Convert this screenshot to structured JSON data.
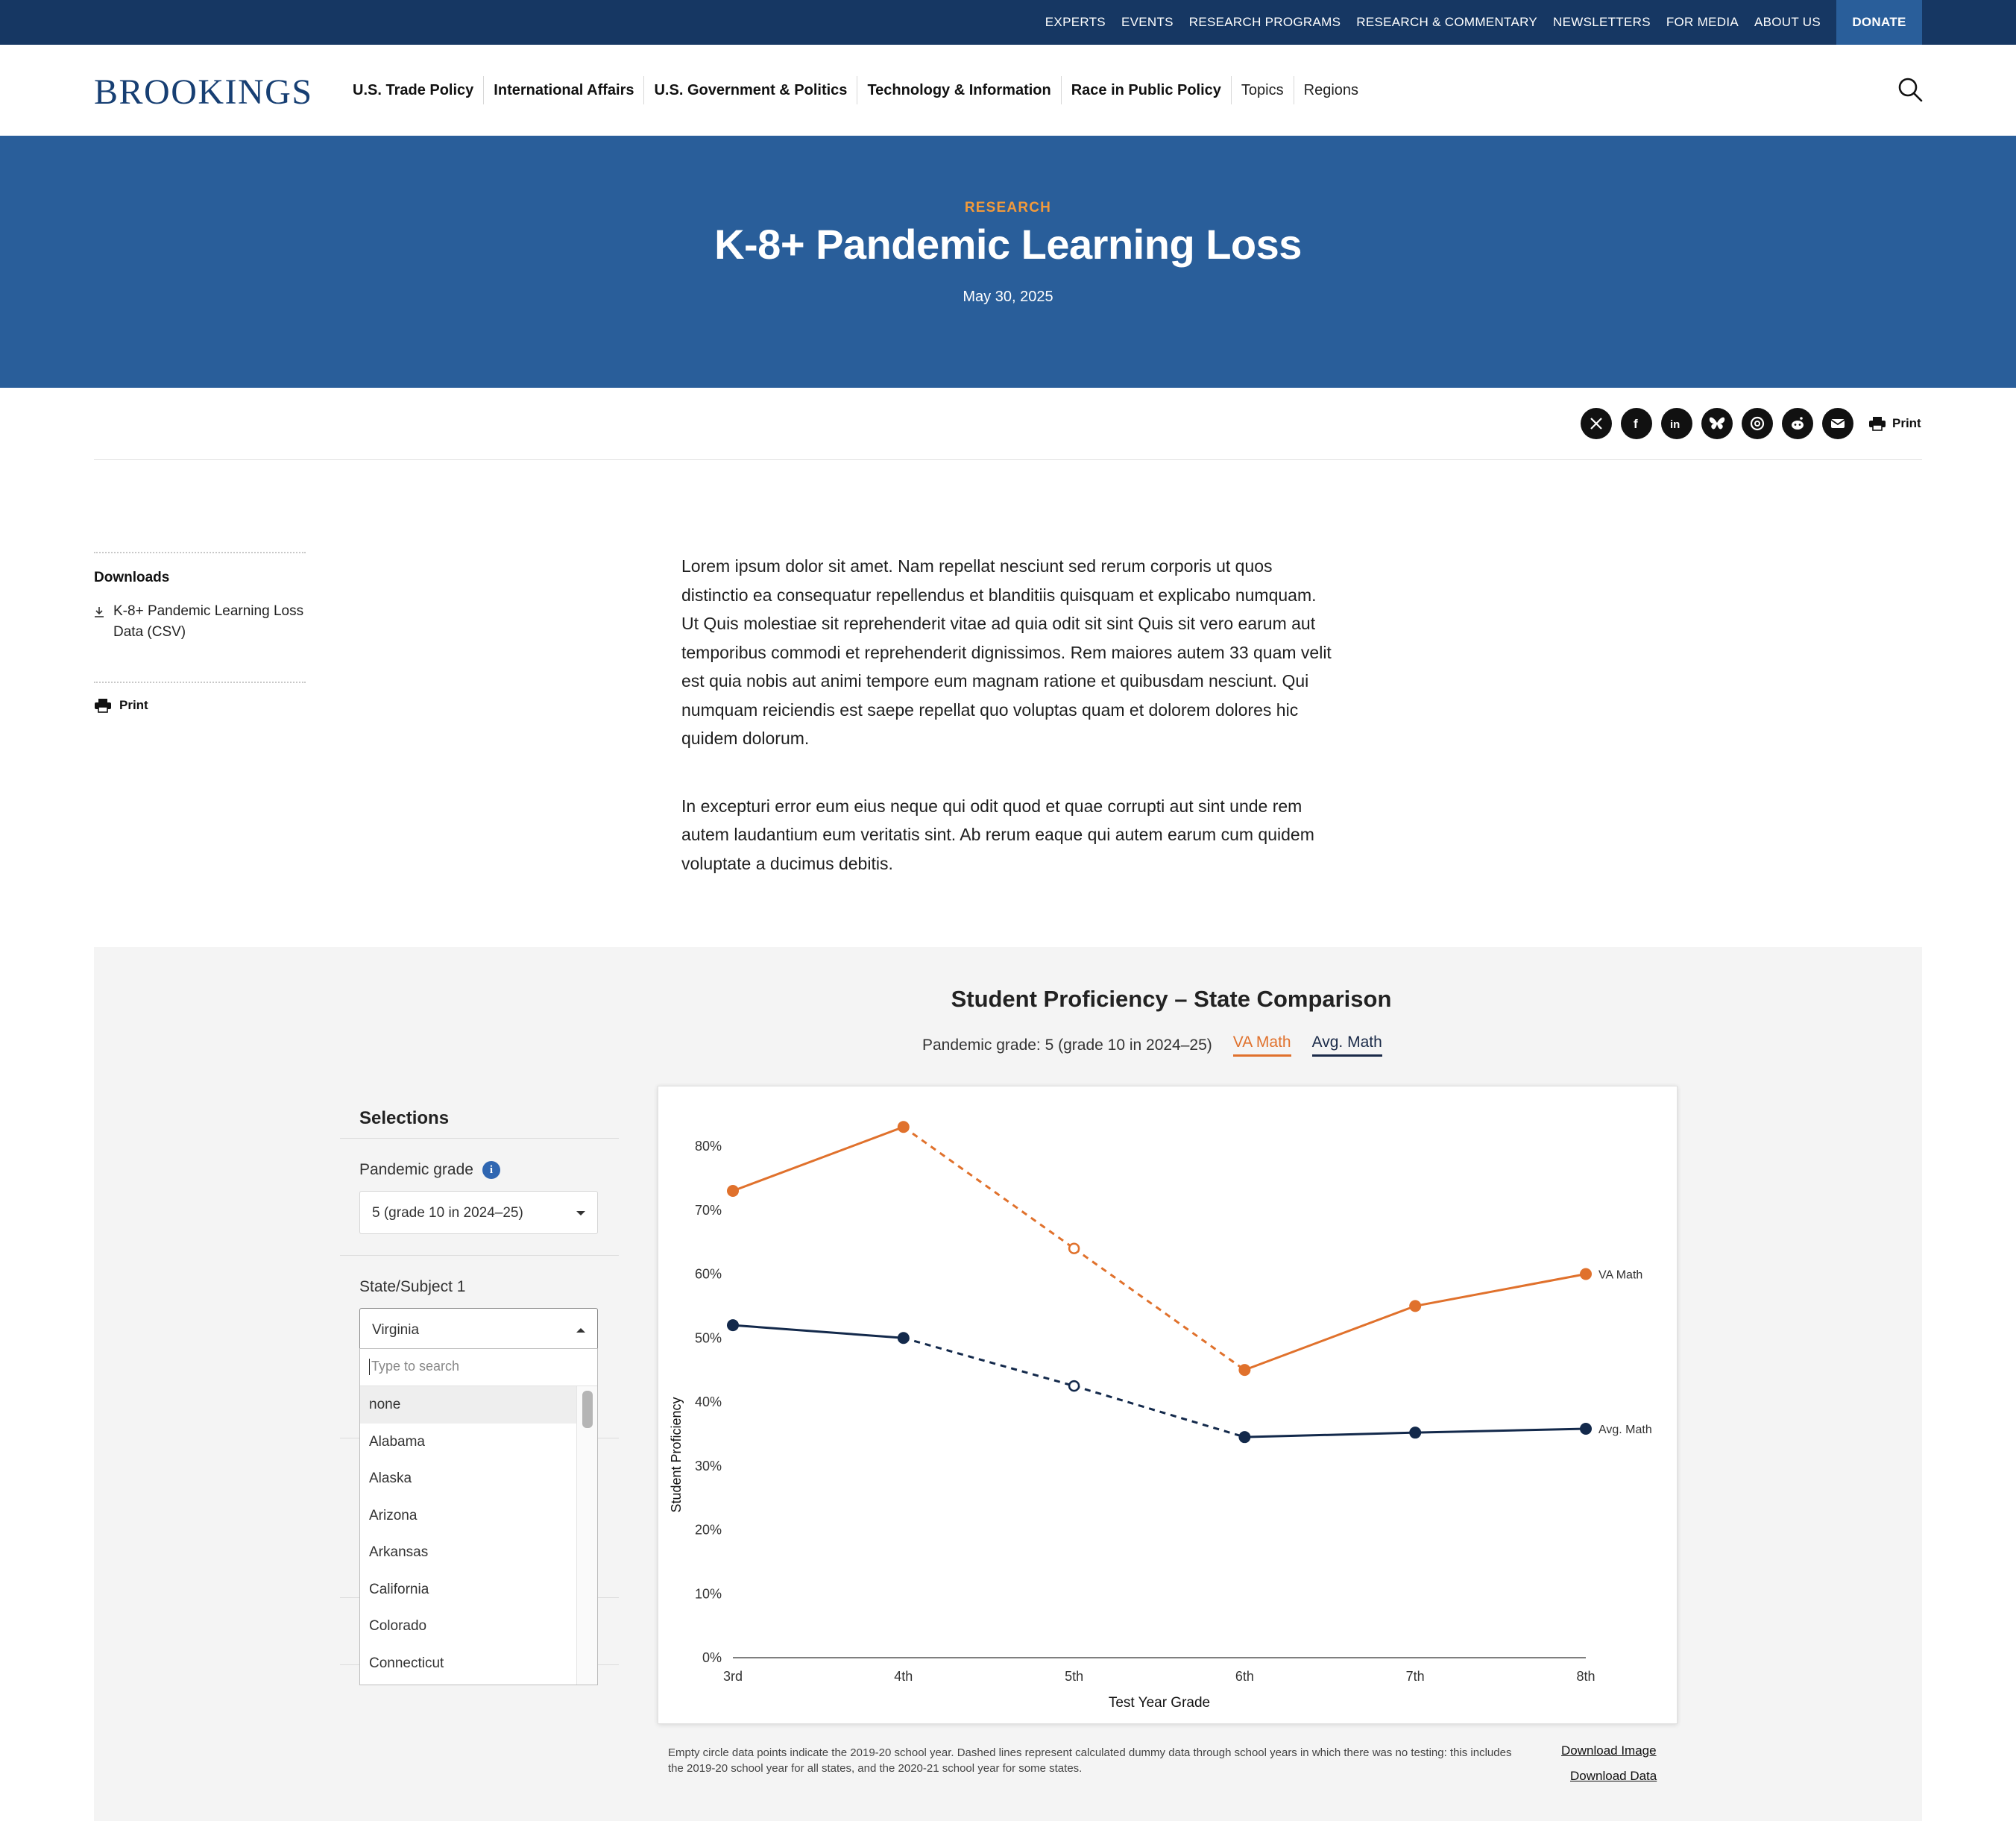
{
  "utility_nav": {
    "links": [
      "EXPERTS",
      "EVENTS",
      "RESEARCH PROGRAMS",
      "RESEARCH & COMMENTARY",
      "NEWSLETTERS",
      "FOR MEDIA",
      "ABOUT US"
    ],
    "donate": "DONATE"
  },
  "header": {
    "logo": "BROOKINGS",
    "nav": [
      {
        "label": "U.S. Trade Policy",
        "style": "strong"
      },
      {
        "label": "International Affairs",
        "style": "strong"
      },
      {
        "label": "U.S. Government & Politics",
        "style": "strong"
      },
      {
        "label": "Technology & Information",
        "style": "strong"
      },
      {
        "label": "Race in Public Policy",
        "style": "strong"
      },
      {
        "label": "Topics",
        "style": "light"
      },
      {
        "label": "Regions",
        "style": "light"
      }
    ],
    "search_icon": "search-icon"
  },
  "hero": {
    "kicker": "RESEARCH",
    "title": "K-8+ Pandemic Learning Loss",
    "date": "May 30, 2025"
  },
  "share": {
    "icons": [
      "x-icon",
      "facebook-icon",
      "linkedin-icon",
      "bluesky-icon",
      "threads-icon",
      "reddit-icon",
      "email-icon"
    ],
    "print_label": "Print"
  },
  "sidebar": {
    "downloads_heading": "Downloads",
    "download_label": "K-8+ Pandemic Learning Loss Data (CSV)",
    "print_label": "Print"
  },
  "article": {
    "paragraphs": [
      "Lorem ipsum dolor sit amet. Nam repellat nesciunt sed rerum corporis ut quos distinctio ea consequatur repellendus et blanditiis quisquam et explicabo numquam. Ut Quis molestiae sit reprehenderit vitae ad quia odit sit sint Quis sit vero earum aut temporibus commodi et reprehenderit dignissimos. Rem maiores autem 33 quam velit est quia nobis aut animi tempore eum magnam ratione et quibusdam nesciunt. Qui numquam reiciendis est saepe repellat quo voluptas quam et dolorem dolores hic quidem dolorum.",
      "In excepturi error eum eius neque qui odit quod et quae corrupti aut sint unde rem autem laudantium eum veritatis sint. Ab rerum eaque qui autem earum cum quidem voluptate a ducimus debitis."
    ]
  },
  "panel": {
    "subtitle": "Pandemic grade: 5 (grade 10 in 2024–25)",
    "legend": [
      "VA Math",
      "Avg. Math"
    ],
    "selections": {
      "heading": "Selections",
      "pandemic_grade_label": "Pandemic grade",
      "pandemic_grade_value": "5 (grade 10 in 2024–25)",
      "state_subject_label": "State/Subject 1",
      "state_subject_value": "Virginia",
      "search_placeholder": "Type to search",
      "options": [
        "none",
        "Alabama",
        "Alaska",
        "Arizona",
        "Arkansas",
        "California",
        "Colorado",
        "Connecticut"
      ]
    },
    "footnote": "Empty circle data points indicate the 2019-20 school year. Dashed lines represent calculated dummy data through school years in which there was no testing: this includes the 2019-20 school year for all states, and the 2020-21 school year for some states.",
    "download_image": "Download Image",
    "download_data": "Download Data"
  },
  "chart_data": {
    "type": "line",
    "title": "Student Proficiency – State Comparison",
    "xlabel": "Test Year Grade",
    "ylabel": "Student Proficiency",
    "categories": [
      "3rd",
      "4th",
      "5th",
      "6th",
      "7th",
      "8th"
    ],
    "ylim": [
      0,
      80
    ],
    "yticks": [
      "0%",
      "10%",
      "20%",
      "30%",
      "40%",
      "50%",
      "60%",
      "70%",
      "80%"
    ],
    "grid": false,
    "series": [
      {
        "name": "VA Math",
        "color": "#e0712c",
        "values": [
          73,
          83,
          64,
          45,
          55,
          60
        ],
        "empty_points": [
          2
        ],
        "dashed_segments": [
          [
            1,
            2
          ],
          [
            2,
            3
          ]
        ]
      },
      {
        "name": "Avg. Math",
        "color": "#13294b",
        "values": [
          52,
          50,
          42.5,
          34.5,
          35.2,
          35.8
        ],
        "empty_points": [
          2
        ],
        "dashed_segments": [
          [
            1,
            2
          ],
          [
            2,
            3
          ]
        ]
      }
    ]
  }
}
